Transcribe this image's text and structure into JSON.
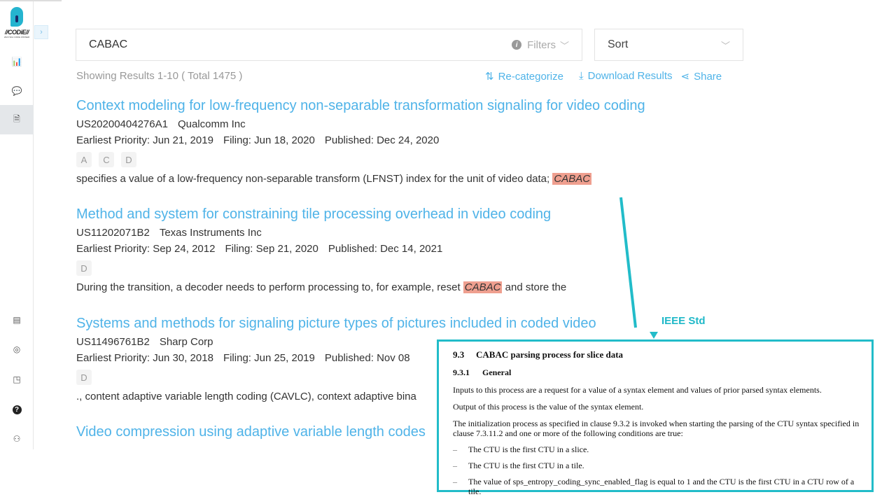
{
  "sidebar": {
    "logo_text": "//CODiE//",
    "logo_sub": "2023 SIIA CODIE WINNER",
    "top_icons": [
      "chart-icon",
      "chat-icon",
      "document-icon"
    ],
    "bottom_icons": [
      "notebook-icon",
      "support-icon",
      "notification-icon",
      "help-icon",
      "user-icon"
    ]
  },
  "search": {
    "query": "CABAC",
    "filters_label": "Filters"
  },
  "sort": {
    "label": "Sort"
  },
  "summary": "Showing Results 1-10 ( Total 1475 )",
  "actions": {
    "recategorize": "Re-categorize",
    "download": "Download Results",
    "share": "Share"
  },
  "results": [
    {
      "title": "Context modeling for low-frequency non-separable transformation signaling for video coding",
      "number": "US20200404276A1",
      "assignee": "Qualcomm Inc",
      "priority": "Earliest Priority: Jun 21, 2019",
      "filing": "Filing: Jun 18, 2020",
      "published": "Published: Dec 24, 2020",
      "tags": [
        "A",
        "C",
        "D"
      ],
      "snippet_pre": "specifies a value of a low-frequency non-separable transform (LFNST) index for the unit of video data; ",
      "snippet_hl": "CABAC",
      "snippet_post": ""
    },
    {
      "title": "Method and system for constraining tile processing overhead in video coding",
      "number": "US11202071B2",
      "assignee": "Texas Instruments Inc",
      "priority": "Earliest Priority: Sep 24, 2012",
      "filing": "Filing: Sep 21, 2020",
      "published": "Published: Dec 14, 2021",
      "tags": [
        "D"
      ],
      "snippet_pre": "During the transition, a decoder needs to perform processing to, for example, reset ",
      "snippet_hl": "CABAC",
      "snippet_post": " and store the"
    },
    {
      "title": "Systems and methods for signaling picture types of pictures included in coded video",
      "number": "US11496761B2",
      "assignee": "Sharp Corp",
      "priority": "Earliest Priority: Jun 30, 2018",
      "filing": "Filing: Jun 25, 2019",
      "published": "Published: Nov 08",
      "tags": [
        "D"
      ],
      "snippet_pre": "., content adaptive variable length coding (CAVLC), context adaptive bina",
      "snippet_hl": "",
      "snippet_post": ""
    },
    {
      "title": "Video compression using adaptive variable length codes"
    }
  ],
  "callout": {
    "label": "IEEE Std",
    "section_num": "9.3",
    "section_title": "CABAC parsing process for slice data",
    "sub_num": "9.3.1",
    "sub_title": "General",
    "p1": "Inputs to this process are a request for a value of a syntax element and values of prior parsed syntax elements.",
    "p2": "Output of this process is the value of the syntax element.",
    "p3": "The initialization process as specified in clause 9.3.2 is invoked when starting the parsing of the CTU syntax specified in clause 7.3.11.2 and one or more of the following conditions are true:",
    "items": [
      "The CTU is the first CTU in a slice.",
      "The CTU is the first CTU in a tile.",
      "The value of sps_entropy_coding_sync_enabled_flag is equal to 1 and the CTU is the first CTU in a CTU row of a tile."
    ],
    "color": "#22bcc9"
  },
  "colors": {
    "link": "#4fb3e8",
    "highlight": "#ef9f8f",
    "accent": "#22bcc9"
  }
}
